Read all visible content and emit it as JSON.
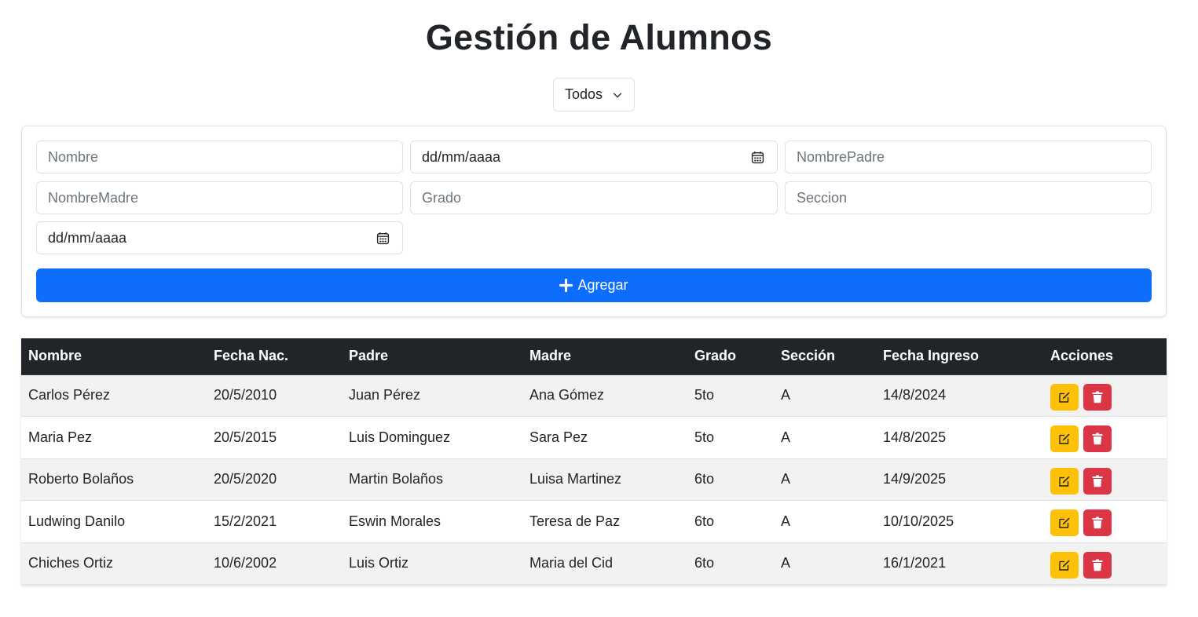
{
  "title": "Gestión de Alumnos",
  "filter": {
    "selected": "Todos"
  },
  "form": {
    "nombre_placeholder": "Nombre",
    "fecha_nac_placeholder": "dd/mm/aaaa",
    "padre_placeholder": "NombrePadre",
    "madre_placeholder": "NombreMadre",
    "grado_placeholder": "Grado",
    "seccion_placeholder": "Seccion",
    "fecha_ingreso_placeholder": "dd/mm/aaaa",
    "add_label": "Agregar"
  },
  "table": {
    "headers": [
      "Nombre",
      "Fecha Nac.",
      "Padre",
      "Madre",
      "Grado",
      "Sección",
      "Fecha Ingreso",
      "Acciones"
    ],
    "rows": [
      [
        "Carlos Pérez",
        "20/5/2010",
        "Juan Pérez",
        "Ana Gómez",
        "5to",
        "A",
        "14/8/2024"
      ],
      [
        "Maria Pez",
        "20/5/2015",
        "Luis Dominguez",
        "Sara Pez",
        "5to",
        "A",
        "14/8/2025"
      ],
      [
        "Roberto Bolaños",
        "20/5/2020",
        "Martin Bolaños",
        "Luisa Martinez",
        "6to",
        "A",
        "14/9/2025"
      ],
      [
        "Ludwing Danilo",
        "15/2/2021",
        "Eswin Morales",
        "Teresa de Paz",
        "6to",
        "A",
        "10/10/2025"
      ],
      [
        "Chiches Ortiz",
        "10/6/2002",
        "Luis Ortiz",
        "Maria del Cid",
        "6to",
        "A",
        "16/1/2021"
      ]
    ]
  },
  "icons": {
    "add": "plus-icon",
    "edit": "edit-icon",
    "delete": "trash-icon",
    "calendar": "calendar-icon",
    "dropdown": "chevron-down-icon"
  },
  "colors": {
    "primary": "#0d6efd",
    "warning": "#ffc107",
    "danger": "#dc3545",
    "header_dark": "#212529"
  }
}
